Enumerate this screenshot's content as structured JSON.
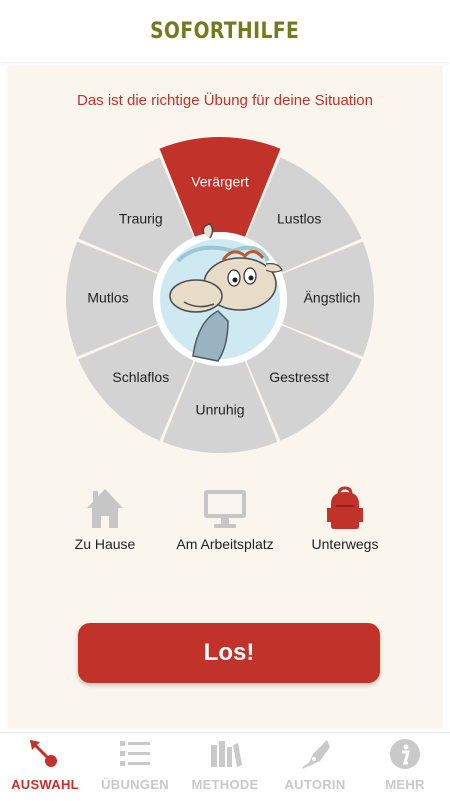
{
  "header": {
    "title": "SOFORTHILFE"
  },
  "subtitle": "Das ist die richtige Übung für deine Situation",
  "wheel": {
    "segments": [
      {
        "label": "Verärgert",
        "selected": true
      },
      {
        "label": "Lustlos",
        "selected": false
      },
      {
        "label": "Ängstlich",
        "selected": false
      },
      {
        "label": "Gestresst",
        "selected": false
      },
      {
        "label": "Unruhig",
        "selected": false
      },
      {
        "label": "Schlaflos",
        "selected": false
      },
      {
        "label": "Mutlos",
        "selected": false
      },
      {
        "label": "Traurig",
        "selected": false
      }
    ]
  },
  "situations": [
    {
      "label": "Zu Hause",
      "icon": "house-icon",
      "selected": false
    },
    {
      "label": "Am Arbeitsplatz",
      "icon": "monitor-icon",
      "selected": false
    },
    {
      "label": "Unterwegs",
      "icon": "backpack-icon",
      "selected": true
    }
  ],
  "action_button": {
    "label": "Los!"
  },
  "tabbar": {
    "tabs": [
      {
        "label": "AUSWAHL",
        "icon": "pointer-icon",
        "active": true
      },
      {
        "label": "ÜBUNGEN",
        "icon": "list-icon",
        "active": false
      },
      {
        "label": "METHODE",
        "icon": "books-icon",
        "active": false
      },
      {
        "label": "AUTORIN",
        "icon": "pen-nib-icon",
        "active": false
      },
      {
        "label": "MEHR",
        "icon": "info-icon",
        "active": false
      }
    ]
  },
  "colors": {
    "accent": "#c0322a",
    "header_title": "#6f7d1e",
    "segment": "#d3d3d3",
    "inactive": "#c9c9c9"
  }
}
